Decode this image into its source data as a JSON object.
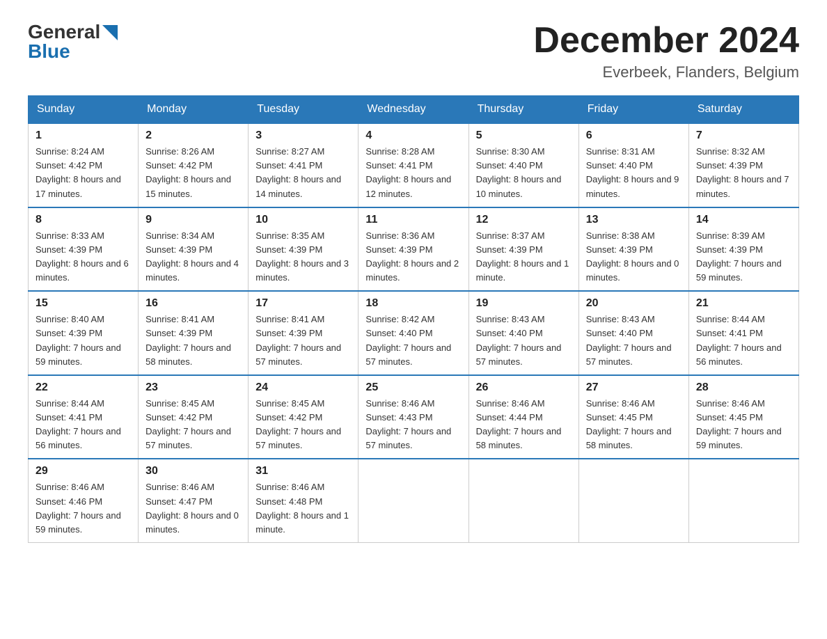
{
  "header": {
    "logo_general": "General",
    "logo_blue": "Blue",
    "month_title": "December 2024",
    "location": "Everbeek, Flanders, Belgium"
  },
  "weekdays": [
    "Sunday",
    "Monday",
    "Tuesday",
    "Wednesday",
    "Thursday",
    "Friday",
    "Saturday"
  ],
  "weeks": [
    [
      {
        "day": "1",
        "sunrise": "8:24 AM",
        "sunset": "4:42 PM",
        "daylight": "8 hours and 17 minutes."
      },
      {
        "day": "2",
        "sunrise": "8:26 AM",
        "sunset": "4:42 PM",
        "daylight": "8 hours and 15 minutes."
      },
      {
        "day": "3",
        "sunrise": "8:27 AM",
        "sunset": "4:41 PM",
        "daylight": "8 hours and 14 minutes."
      },
      {
        "day": "4",
        "sunrise": "8:28 AM",
        "sunset": "4:41 PM",
        "daylight": "8 hours and 12 minutes."
      },
      {
        "day": "5",
        "sunrise": "8:30 AM",
        "sunset": "4:40 PM",
        "daylight": "8 hours and 10 minutes."
      },
      {
        "day": "6",
        "sunrise": "8:31 AM",
        "sunset": "4:40 PM",
        "daylight": "8 hours and 9 minutes."
      },
      {
        "day": "7",
        "sunrise": "8:32 AM",
        "sunset": "4:39 PM",
        "daylight": "8 hours and 7 minutes."
      }
    ],
    [
      {
        "day": "8",
        "sunrise": "8:33 AM",
        "sunset": "4:39 PM",
        "daylight": "8 hours and 6 minutes."
      },
      {
        "day": "9",
        "sunrise": "8:34 AM",
        "sunset": "4:39 PM",
        "daylight": "8 hours and 4 minutes."
      },
      {
        "day": "10",
        "sunrise": "8:35 AM",
        "sunset": "4:39 PM",
        "daylight": "8 hours and 3 minutes."
      },
      {
        "day": "11",
        "sunrise": "8:36 AM",
        "sunset": "4:39 PM",
        "daylight": "8 hours and 2 minutes."
      },
      {
        "day": "12",
        "sunrise": "8:37 AM",
        "sunset": "4:39 PM",
        "daylight": "8 hours and 1 minute."
      },
      {
        "day": "13",
        "sunrise": "8:38 AM",
        "sunset": "4:39 PM",
        "daylight": "8 hours and 0 minutes."
      },
      {
        "day": "14",
        "sunrise": "8:39 AM",
        "sunset": "4:39 PM",
        "daylight": "7 hours and 59 minutes."
      }
    ],
    [
      {
        "day": "15",
        "sunrise": "8:40 AM",
        "sunset": "4:39 PM",
        "daylight": "7 hours and 59 minutes."
      },
      {
        "day": "16",
        "sunrise": "8:41 AM",
        "sunset": "4:39 PM",
        "daylight": "7 hours and 58 minutes."
      },
      {
        "day": "17",
        "sunrise": "8:41 AM",
        "sunset": "4:39 PM",
        "daylight": "7 hours and 57 minutes."
      },
      {
        "day": "18",
        "sunrise": "8:42 AM",
        "sunset": "4:40 PM",
        "daylight": "7 hours and 57 minutes."
      },
      {
        "day": "19",
        "sunrise": "8:43 AM",
        "sunset": "4:40 PM",
        "daylight": "7 hours and 57 minutes."
      },
      {
        "day": "20",
        "sunrise": "8:43 AM",
        "sunset": "4:40 PM",
        "daylight": "7 hours and 57 minutes."
      },
      {
        "day": "21",
        "sunrise": "8:44 AM",
        "sunset": "4:41 PM",
        "daylight": "7 hours and 56 minutes."
      }
    ],
    [
      {
        "day": "22",
        "sunrise": "8:44 AM",
        "sunset": "4:41 PM",
        "daylight": "7 hours and 56 minutes."
      },
      {
        "day": "23",
        "sunrise": "8:45 AM",
        "sunset": "4:42 PM",
        "daylight": "7 hours and 57 minutes."
      },
      {
        "day": "24",
        "sunrise": "8:45 AM",
        "sunset": "4:42 PM",
        "daylight": "7 hours and 57 minutes."
      },
      {
        "day": "25",
        "sunrise": "8:46 AM",
        "sunset": "4:43 PM",
        "daylight": "7 hours and 57 minutes."
      },
      {
        "day": "26",
        "sunrise": "8:46 AM",
        "sunset": "4:44 PM",
        "daylight": "7 hours and 58 minutes."
      },
      {
        "day": "27",
        "sunrise": "8:46 AM",
        "sunset": "4:45 PM",
        "daylight": "7 hours and 58 minutes."
      },
      {
        "day": "28",
        "sunrise": "8:46 AM",
        "sunset": "4:45 PM",
        "daylight": "7 hours and 59 minutes."
      }
    ],
    [
      {
        "day": "29",
        "sunrise": "8:46 AM",
        "sunset": "4:46 PM",
        "daylight": "7 hours and 59 minutes."
      },
      {
        "day": "30",
        "sunrise": "8:46 AM",
        "sunset": "4:47 PM",
        "daylight": "8 hours and 0 minutes."
      },
      {
        "day": "31",
        "sunrise": "8:46 AM",
        "sunset": "4:48 PM",
        "daylight": "8 hours and 1 minute."
      },
      null,
      null,
      null,
      null
    ]
  ]
}
